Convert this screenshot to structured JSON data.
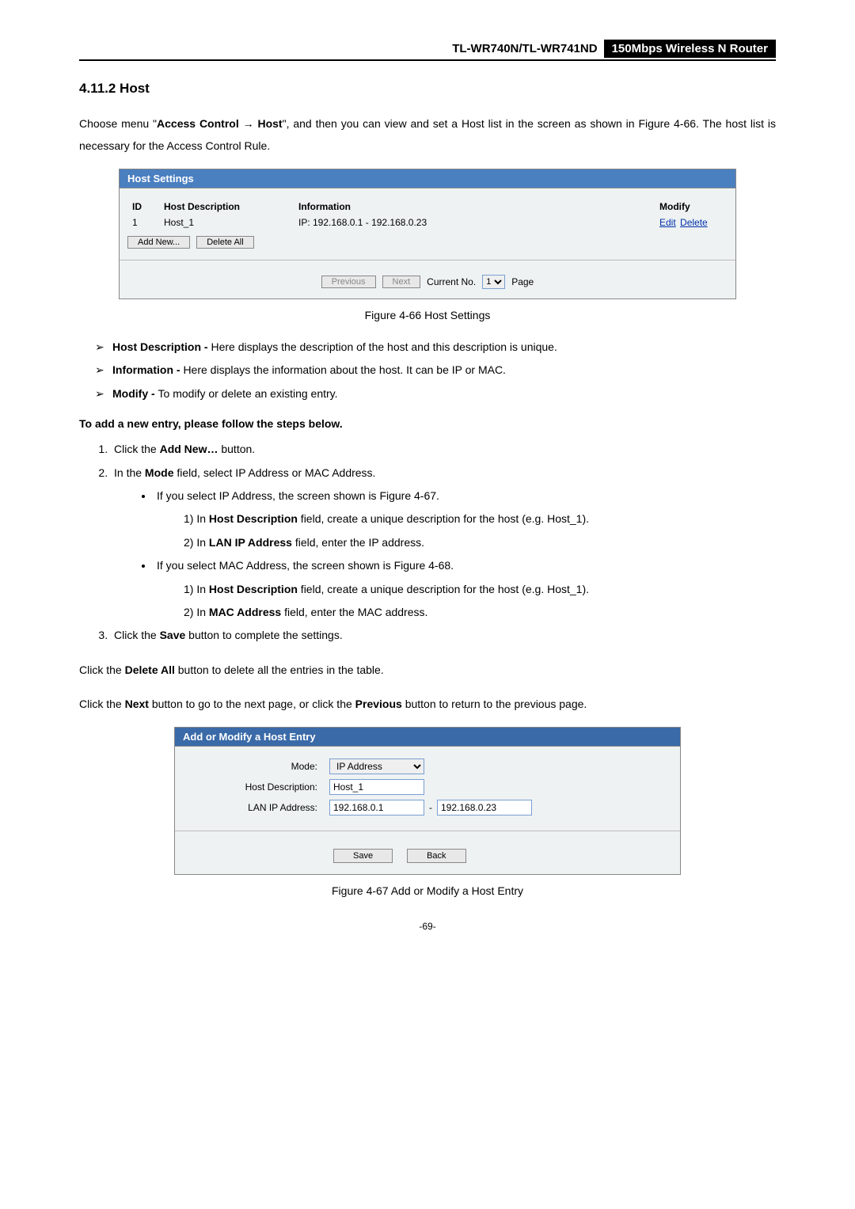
{
  "header": {
    "model": "TL-WR740N/TL-WR741ND",
    "product": "150Mbps Wireless N Router"
  },
  "section_title": "4.11.2  Host",
  "intro_part1": "Choose menu \"",
  "intro_bold1": "Access Control",
  "intro_arrow": " → ",
  "intro_bold2": "Host",
  "intro_part2": "\", and then you can view and set a Host list in the screen as shown in Figure 4-66. The host list is necessary for the Access Control Rule.",
  "fig66": {
    "panel_title": "Host Settings",
    "cols": {
      "id": "ID",
      "desc": "Host Description",
      "info": "Information",
      "modify": "Modify"
    },
    "row": {
      "id": "1",
      "desc": "Host_1",
      "info": "IP: 192.168.0.1 - 192.168.0.23",
      "edit": "Edit",
      "delete": "Delete"
    },
    "add_new": "Add New...",
    "delete_all": "Delete All",
    "prev": "Previous",
    "next": "Next",
    "current_no": "Current No.",
    "page_sel": "1",
    "page_label": "Page"
  },
  "fig66_caption": "Figure 4-66    Host Settings",
  "list": {
    "i1_b": "Host Description - ",
    "i1": "Here displays the description of the host and this description is unique.",
    "i2_b": "Information - ",
    "i2": "Here displays the information about the host. It can be IP or MAC.",
    "i3_b": "Modify - ",
    "i3": "To modify or delete an existing entry."
  },
  "add_heading": "To add a new entry, please follow the steps below.",
  "steps": {
    "s1a": "Click the ",
    "s1b": "Add New…",
    "s1c": " button.",
    "s2a": "In the ",
    "s2b": "Mode",
    "s2c": " field, select IP Address or MAC Address.",
    "b1": "If you select IP Address, the screen shown is Figure 4-67.",
    "b1_1a": "1)   In ",
    "b1_1b": "Host Description",
    "b1_1c": " field, create a unique description for the host (e.g. Host_1).",
    "b1_2a": "2)   In ",
    "b1_2b": "LAN IP Address",
    "b1_2c": " field, enter the IP address.",
    "b2": "If you select MAC Address, the screen shown is Figure 4-68.",
    "b2_1a": "1)   In ",
    "b2_1b": "Host Description",
    "b2_1c": " field, create a unique description for the host (e.g. Host_1).",
    "b2_2a": "2)   In ",
    "b2_2b": "MAC Address",
    "b2_2c": " field, enter the MAC address.",
    "s3a": "Click the ",
    "s3b": "Save",
    "s3c": " button to complete the settings."
  },
  "p_delete_a": "Click the ",
  "p_delete_b": "Delete All",
  "p_delete_c": " button to delete all the entries in the table.",
  "p_next_a": "Click the ",
  "p_next_b": "Next",
  "p_next_c": " button to go to the next page, or click the ",
  "p_next_d": "Previous",
  "p_next_e": " button to return to the previous page.",
  "fig67": {
    "panel_title": "Add or Modify a Host Entry",
    "mode_label": "Mode:",
    "mode_value": "IP Address",
    "desc_label": "Host Description:",
    "desc_value": "Host_1",
    "ip_label": "LAN IP Address:",
    "ip1": "192.168.0.1",
    "ip2": "192.168.0.23",
    "save": "Save",
    "back": "Back"
  },
  "fig67_caption": "Figure 4-67    Add or Modify a Host Entry",
  "page_num": "-69-"
}
